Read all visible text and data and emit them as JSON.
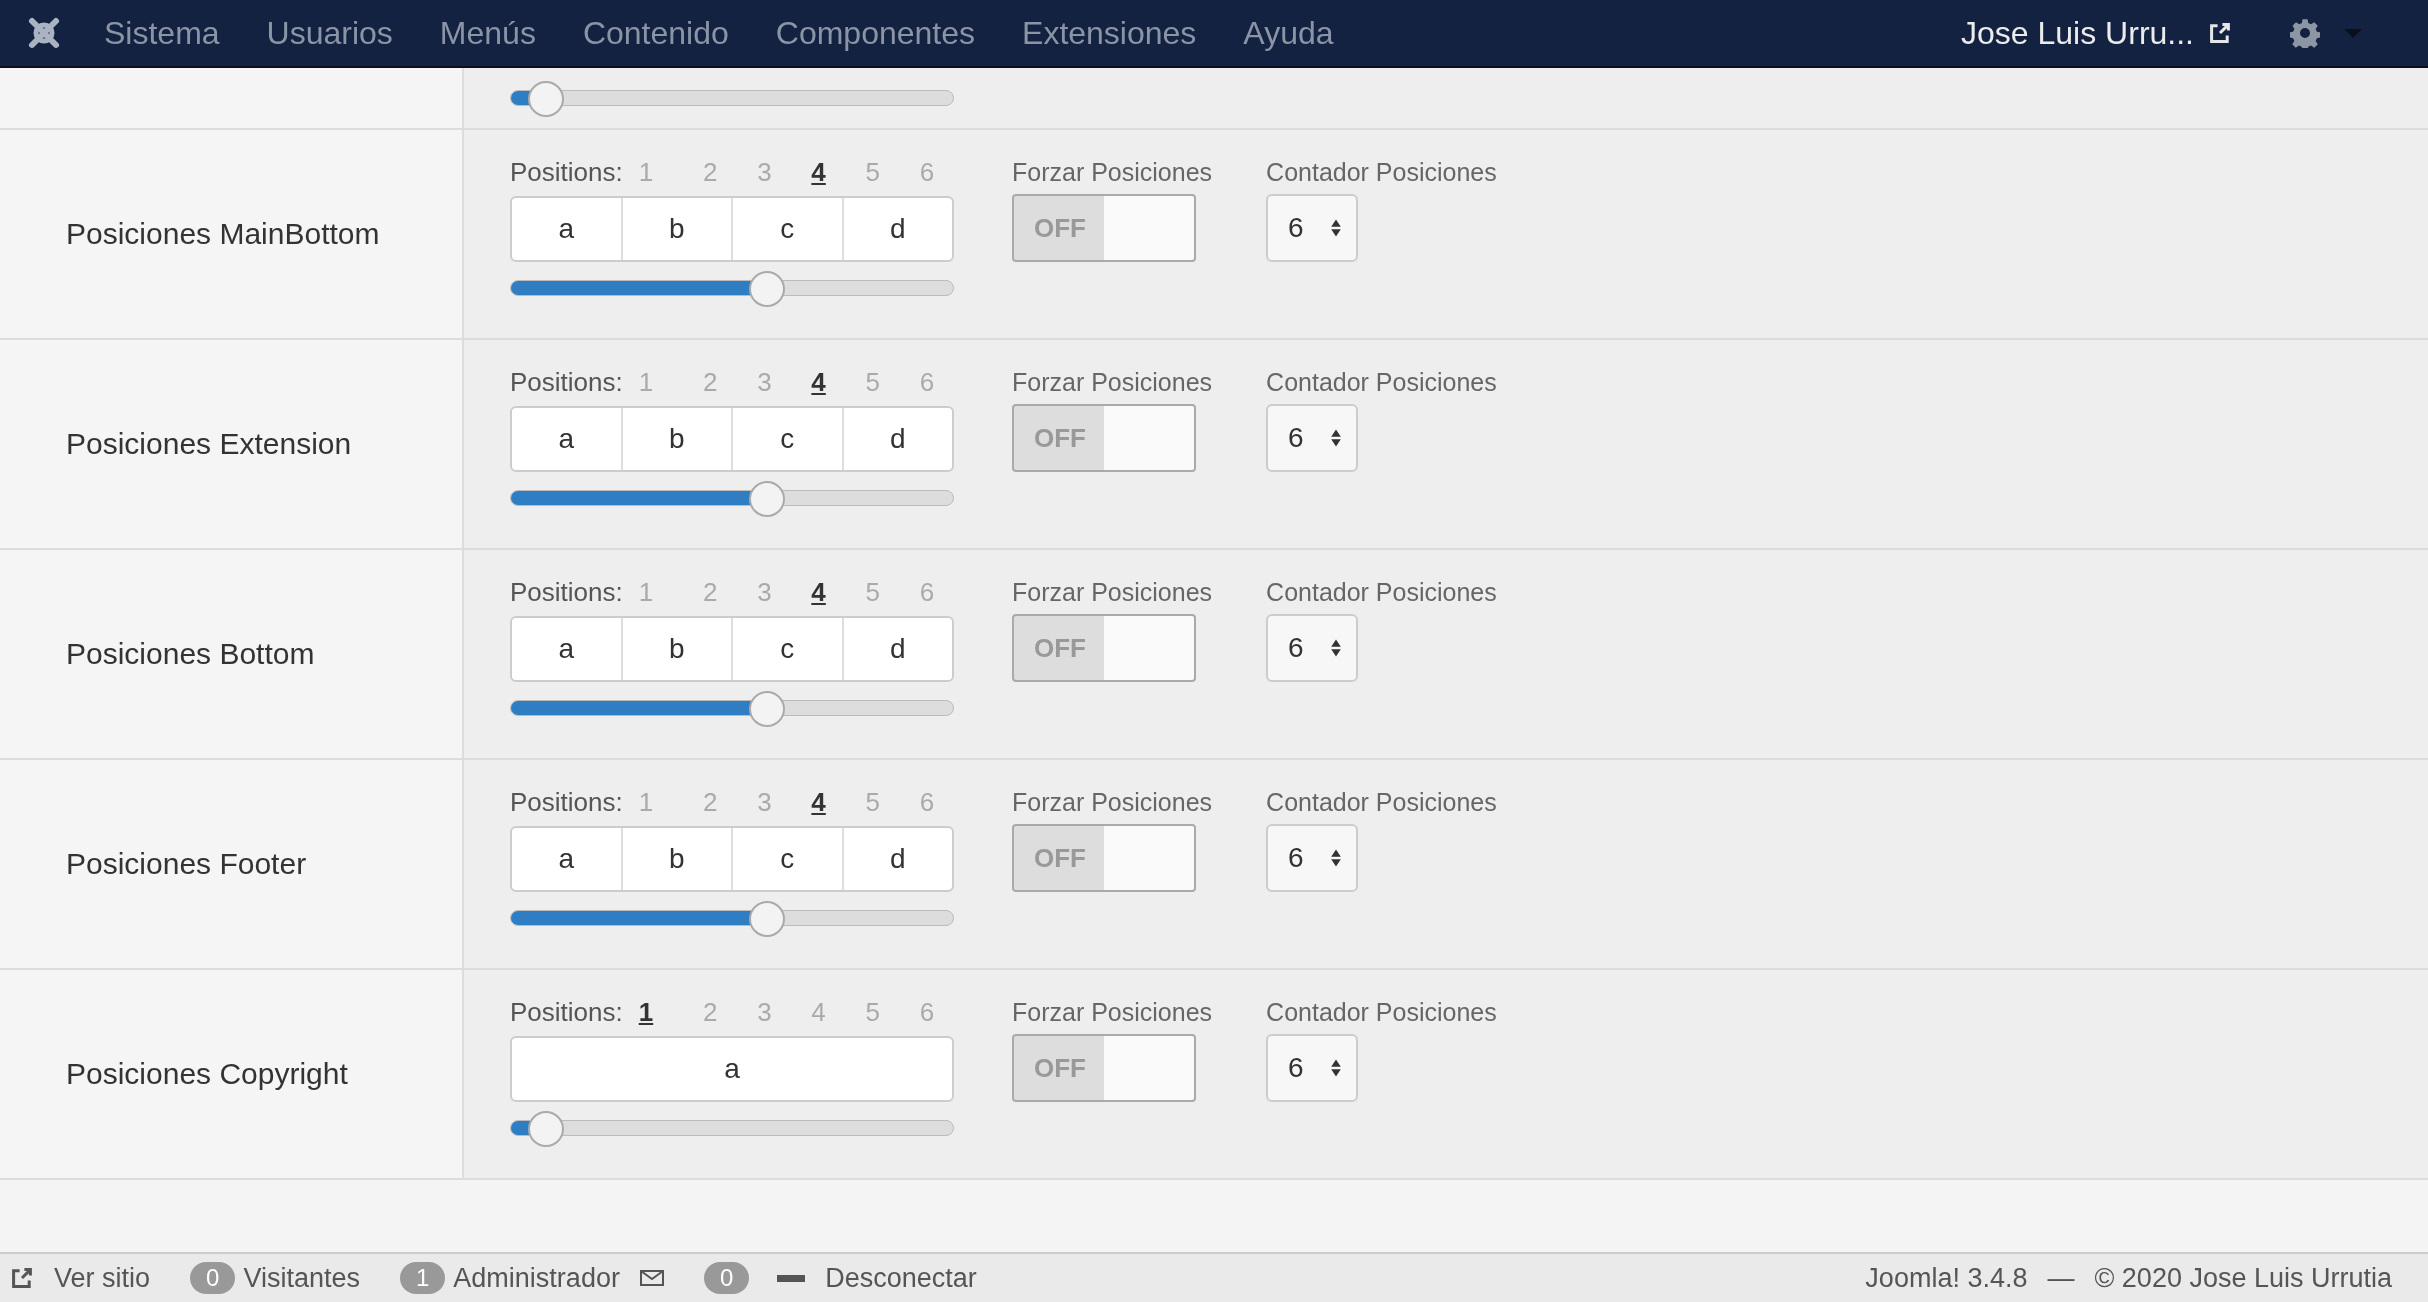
{
  "navbar": {
    "menu": [
      "Sistema",
      "Usuarios",
      "Menús",
      "Contenido",
      "Componentes",
      "Extensiones",
      "Ayuda"
    ],
    "user": "Jose Luis Urru..."
  },
  "top_slider": {
    "level": 0.08
  },
  "rows": [
    {
      "label": "Posiciones MainBottom",
      "positions_label": "Positions:",
      "positions": [
        {
          "label": "1",
          "selected": false
        },
        {
          "label": "2",
          "selected": false
        },
        {
          "label": "3",
          "selected": false
        },
        {
          "label": "4",
          "selected": true
        },
        {
          "label": "5",
          "selected": false
        },
        {
          "label": "6",
          "selected": false
        }
      ],
      "cells": [
        "a",
        "b",
        "c",
        "d"
      ],
      "level": 0.58,
      "force_label": "Forzar Posiciones",
      "force": {
        "label": "OFF",
        "on": false
      },
      "counter_label": "Contador Posiciones",
      "counter": "6"
    },
    {
      "label": "Posiciones Extension",
      "positions_label": "Positions:",
      "positions": [
        {
          "label": "1",
          "selected": false
        },
        {
          "label": "2",
          "selected": false
        },
        {
          "label": "3",
          "selected": false
        },
        {
          "label": "4",
          "selected": true
        },
        {
          "label": "5",
          "selected": false
        },
        {
          "label": "6",
          "selected": false
        }
      ],
      "cells": [
        "a",
        "b",
        "c",
        "d"
      ],
      "level": 0.58,
      "force_label": "Forzar Posiciones",
      "force": {
        "label": "OFF",
        "on": false
      },
      "counter_label": "Contador Posiciones",
      "counter": "6"
    },
    {
      "label": "Posiciones Bottom",
      "positions_label": "Positions:",
      "positions": [
        {
          "label": "1",
          "selected": false
        },
        {
          "label": "2",
          "selected": false
        },
        {
          "label": "3",
          "selected": false
        },
        {
          "label": "4",
          "selected": true
        },
        {
          "label": "5",
          "selected": false
        },
        {
          "label": "6",
          "selected": false
        }
      ],
      "cells": [
        "a",
        "b",
        "c",
        "d"
      ],
      "level": 0.58,
      "force_label": "Forzar Posiciones",
      "force": {
        "label": "OFF",
        "on": false
      },
      "counter_label": "Contador Posiciones",
      "counter": "6"
    },
    {
      "label": "Posiciones Footer",
      "positions_label": "Positions:",
      "positions": [
        {
          "label": "1",
          "selected": false
        },
        {
          "label": "2",
          "selected": false
        },
        {
          "label": "3",
          "selected": false
        },
        {
          "label": "4",
          "selected": true
        },
        {
          "label": "5",
          "selected": false
        },
        {
          "label": "6",
          "selected": false
        }
      ],
      "cells": [
        "a",
        "b",
        "c",
        "d"
      ],
      "level": 0.58,
      "force_label": "Forzar Posiciones",
      "force": {
        "label": "OFF",
        "on": false
      },
      "counter_label": "Contador Posiciones",
      "counter": "6"
    },
    {
      "label": "Posiciones Copyright",
      "positions_label": "Positions:",
      "positions": [
        {
          "label": "1",
          "selected": true
        },
        {
          "label": "2",
          "selected": false
        },
        {
          "label": "3",
          "selected": false
        },
        {
          "label": "4",
          "selected": false
        },
        {
          "label": "5",
          "selected": false
        },
        {
          "label": "6",
          "selected": false
        }
      ],
      "cells": [
        "a"
      ],
      "level": 0.08,
      "force_label": "Forzar Posiciones",
      "force": {
        "label": "OFF",
        "on": false
      },
      "counter_label": "Contador Posiciones",
      "counter": "6"
    }
  ],
  "status_bar": {
    "view_site": "Ver sitio",
    "visitors_count": "0",
    "visitors": "Visitantes",
    "admins_count": "1",
    "admins": "Administrador",
    "messages_count": "0",
    "logout": "Desconectar",
    "version": "Joomla! 3.4.8",
    "separator": "—",
    "copyright": "© 2020 Jose Luis Urrutia"
  }
}
